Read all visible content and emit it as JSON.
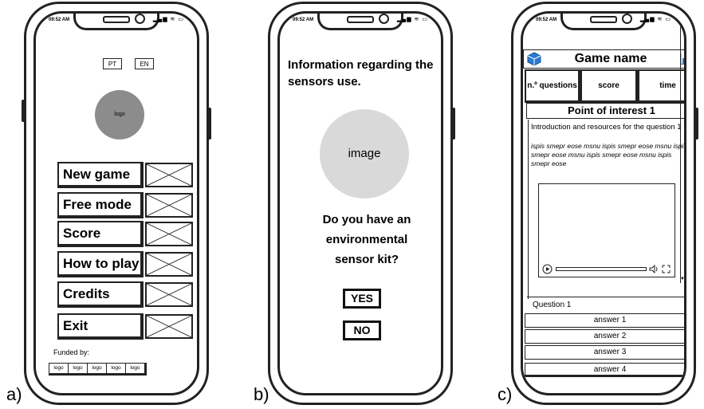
{
  "labels": {
    "a": "a)",
    "b": "b)",
    "c": "c)"
  },
  "status_bar": {
    "time": "09:52 AM",
    "icons": "signal wifi battery"
  },
  "panel_a": {
    "languages": [
      "PT",
      "EN"
    ],
    "logo": "logo",
    "menu": [
      "New game",
      "Free mode",
      "Score",
      "How to play",
      "Credits",
      "Exit"
    ],
    "funded_label": "Funded by:",
    "funder_logos": [
      "logo",
      "logo",
      "logo",
      "logo",
      "logo"
    ]
  },
  "panel_b": {
    "info": "Information regarding the sensors use.",
    "image": "image",
    "question_lines": [
      "Do you have an",
      "environmental",
      "sensor kit?"
    ],
    "yes": "YES",
    "no": "NO"
  },
  "panel_c": {
    "game_name": "Game name",
    "tabs": [
      "n.º questions",
      "score",
      "time"
    ],
    "poi": "Point of interest 1",
    "intro": "Introduction and resources for the question 1",
    "lorem": "ispis smepr eose msnu ispis smepr eose msnu ispis smepr eose msnu ispis smepr eose msnu ispis smepr eose",
    "question": "Question 1",
    "answers": [
      "answer 1",
      "answer 2",
      "answer 3",
      "answer 4"
    ],
    "colors": {
      "accent": "#2b7bd3"
    }
  }
}
